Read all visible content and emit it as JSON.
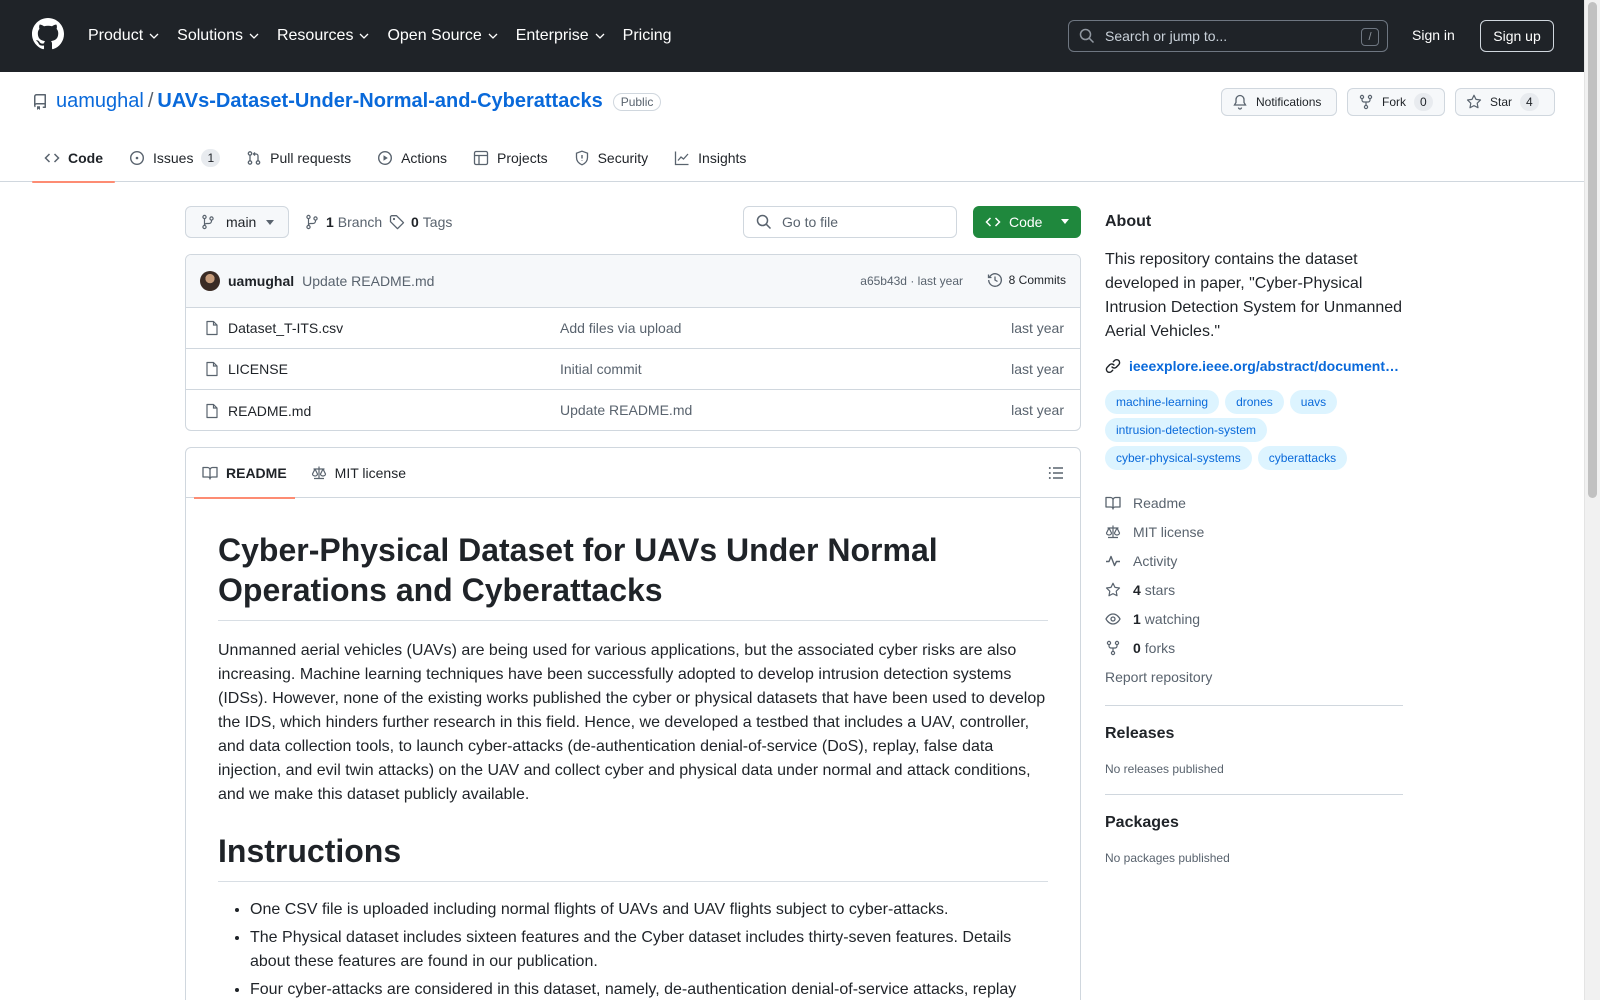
{
  "header": {
    "nav": [
      "Product",
      "Solutions",
      "Resources",
      "Open Source",
      "Enterprise",
      "Pricing"
    ],
    "search_placeholder": "Search or jump to...",
    "search_shortcut": "/",
    "signin": "Sign in",
    "signup": "Sign up"
  },
  "repo": {
    "owner": "uamughal",
    "separator": "/",
    "name": "UAVs-Dataset-Under-Normal-and-Cyberattacks",
    "visibility": "Public",
    "notifications_label": "Notifications",
    "fork_label": "Fork",
    "fork_count": "0",
    "star_label": "Star",
    "star_count": "4"
  },
  "tabs": [
    {
      "label": "Code",
      "icon": "code-icon"
    },
    {
      "label": "Issues",
      "icon": "issue-icon",
      "count": "1"
    },
    {
      "label": "Pull requests",
      "icon": "pull-request-icon"
    },
    {
      "label": "Actions",
      "icon": "play-icon"
    },
    {
      "label": "Projects",
      "icon": "table-icon"
    },
    {
      "label": "Security",
      "icon": "shield-icon"
    },
    {
      "label": "Insights",
      "icon": "graph-icon"
    }
  ],
  "toolbar": {
    "branch": "main",
    "branch_count": "1",
    "branch_label": "Branch",
    "tag_count": "0",
    "tag_label": "Tags",
    "goto_placeholder": "Go to file",
    "code_label": "Code"
  },
  "commit": {
    "author": "uamughal",
    "message": "Update README.md",
    "hash_time": "a65b43d · last year",
    "commits_label": "8 Commits"
  },
  "files": [
    {
      "name": "Dataset_T-ITS.csv",
      "commit": "Add files via upload",
      "time": "last year"
    },
    {
      "name": "LICENSE",
      "commit": "Initial commit",
      "time": "last year"
    },
    {
      "name": "README.md",
      "commit": "Update README.md",
      "time": "last year"
    }
  ],
  "readme": {
    "tab_readme": "README",
    "tab_license": "MIT license",
    "title": "Cyber-Physical Dataset for UAVs Under Normal Operations and Cyberattacks",
    "intro": "Unmanned aerial vehicles (UAVs) are being used for various applications, but the associated cyber risks are also increasing. Machine learning techniques have been successfully adopted to develop intrusion detection systems (IDSs). However, none of the existing works published the cyber or physical datasets that have been used to develop the IDS, which hinders further research in this field. Hence, we developed a testbed that includes a UAV, controller, and data collection tools, to launch cyber-attacks (de-authentication denial-of-service (DoS), replay, false data injection, and evil twin attacks) on the UAV and collect cyber and physical data under normal and attack conditions, and we make this dataset publicly available.",
    "instructions_heading": "Instructions",
    "bullets": [
      "One CSV file is uploaded including normal flights of UAVs and UAV flights subject to cyber-attacks.",
      "The Physical dataset includes sixteen features and the Cyber dataset includes thirty-seven features. Details about these features are found in our publication.",
      "Four cyber-attacks are considered in this dataset, namely, de-authentication denial-of-service attacks, replay"
    ]
  },
  "about": {
    "heading": "About",
    "description": "This repository contains the dataset developed in paper, \"Cyber-Physical Intrusion Detection System for Unmanned Aerial Vehicles.\"",
    "link": "ieeexplore.ieee.org/abstract/document…",
    "topics": [
      "machine-learning",
      "drones",
      "uavs",
      "intrusion-detection-system",
      "cyber-physical-systems",
      "cyberattacks"
    ],
    "readme": "Readme",
    "license": "MIT license",
    "activity": "Activity",
    "stars_count": "4",
    "stars_label": "stars",
    "watching_count": "1",
    "watching_label": "watching",
    "forks_count": "0",
    "forks_label": "forks",
    "report": "Report repository"
  },
  "releases": {
    "heading": "Releases",
    "empty": "No releases published"
  },
  "packages": {
    "heading": "Packages",
    "empty": "No packages published"
  }
}
